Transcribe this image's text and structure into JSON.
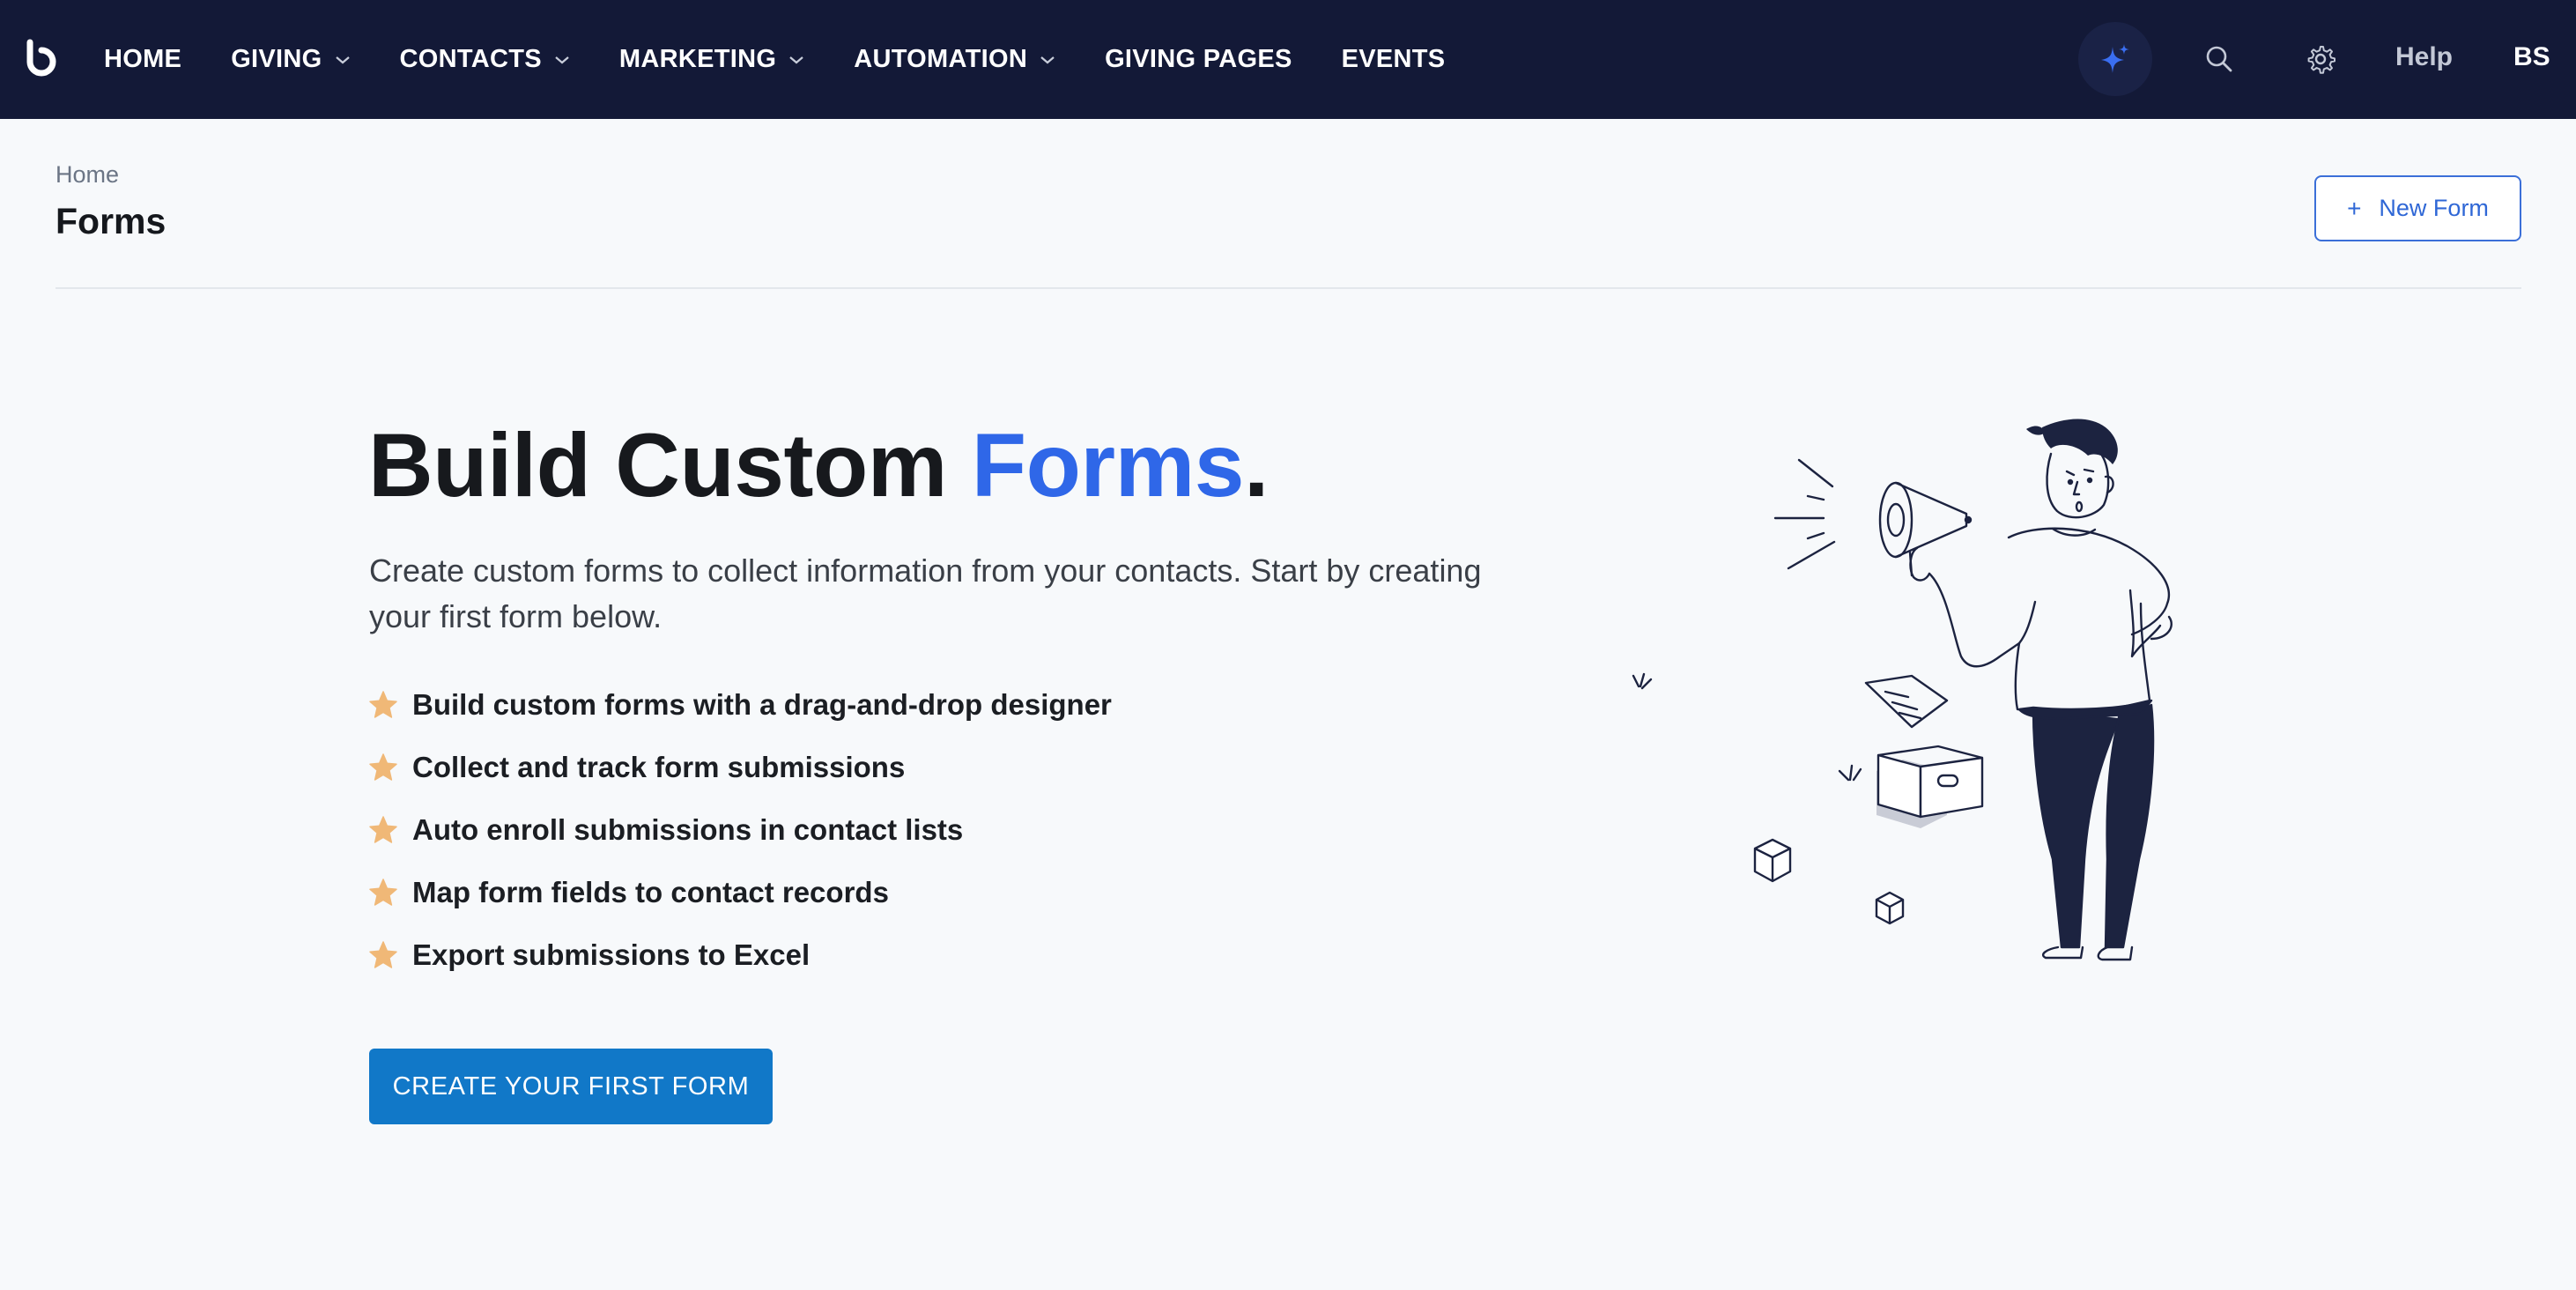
{
  "nav": {
    "items": [
      {
        "label": "HOME",
        "has_dropdown": false
      },
      {
        "label": "GIVING",
        "has_dropdown": true
      },
      {
        "label": "CONTACTS",
        "has_dropdown": true
      },
      {
        "label": "MARKETING",
        "has_dropdown": true
      },
      {
        "label": "AUTOMATION",
        "has_dropdown": true
      },
      {
        "label": "GIVING PAGES",
        "has_dropdown": false
      },
      {
        "label": "EVENTS",
        "has_dropdown": false
      }
    ],
    "help_label": "Help",
    "user_initials": "BS",
    "icons": [
      "logo-icon",
      "sparkle-icon",
      "search-icon",
      "gear-icon"
    ]
  },
  "header": {
    "breadcrumb": "Home",
    "title": "Forms",
    "new_form_label": "New Form"
  },
  "hero": {
    "title_prefix": "Build Custom ",
    "title_accent": "Forms",
    "title_suffix": ".",
    "description": "Create custom forms to collect information from your contacts. Start by creating your first form below.",
    "features": [
      "Build custom forms with a drag-and-drop designer",
      "Collect and track form submissions",
      "Auto enroll submissions in contact lists",
      "Map form fields to contact records",
      "Export submissions to Excel"
    ],
    "cta_label": "CREATE YOUR FIRST FORM"
  },
  "colors": {
    "nav_bg": "#131937",
    "accent": "#2f67e8",
    "cta": "#1178c8",
    "star": "#f0b877",
    "page_bg": "#f7f9fb"
  }
}
